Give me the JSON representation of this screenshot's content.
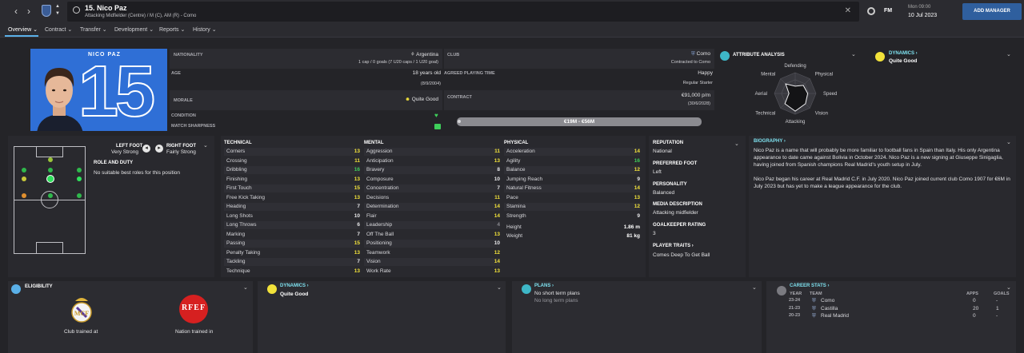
{
  "topbar": {
    "title": "15. Nico Paz",
    "subtitle": "Attacking Midfielder (Centre) / M (C), AM (R) - Como",
    "fm_label": "FM",
    "time": "Mon 09:00",
    "date": "10 Jul 2023",
    "add_manager": "ADD MANAGER"
  },
  "tabs": [
    "Overview",
    "Contract",
    "Transfer",
    "Development",
    "Reports",
    "History"
  ],
  "card": {
    "name": "NICO PAZ",
    "number": "15"
  },
  "info": {
    "nationality_label": "NATIONALITY",
    "nationality": "Argentina",
    "caps": "1 cap / 0 goals (7 U20 caps / 1 U20 goal)",
    "club_label": "CLUB",
    "club": "Como",
    "club_status": "Contracted to Como",
    "age_label": "AGE",
    "age": "18 years old",
    "dob": "(8/9/2004)",
    "playing_time_label": "AGREED PLAYING TIME",
    "happiness": "Happy",
    "playing_time": "Regular Starter",
    "morale_label": "MORALE",
    "morale": "Quite Good",
    "contract_label": "CONTRACT",
    "wage": "€91,000 p/m",
    "contract_end": "(30/6/2028)",
    "condition_label": "CONDITION",
    "sharpness_label": "MATCH SHARPNESS",
    "value_range": "€19M - €56M"
  },
  "attribute_analysis": {
    "title": "ATTRIBUTE ANALYSIS",
    "labels": [
      "Defending",
      "Physical",
      "Speed",
      "Vision",
      "Attacking",
      "Technical",
      "Aerial",
      "Mental"
    ],
    "values": [
      0.35,
      0.55,
      0.6,
      0.7,
      0.85,
      0.7,
      0.3,
      0.65
    ]
  },
  "dynamics_top": {
    "title": "DYNAMICS",
    "value": "Quite Good"
  },
  "feet": {
    "left_label": "LEFT FOOT",
    "left": "Very Strong",
    "right_label": "RIGHT FOOT",
    "right": "Fairly Strong"
  },
  "role": {
    "title": "ROLE AND DUTY",
    "text": "No suitable best roles for this position"
  },
  "technical": {
    "title": "TECHNICAL",
    "items": [
      {
        "name": "Corners",
        "value": "13"
      },
      {
        "name": "Crossing",
        "value": "11"
      },
      {
        "name": "Dribbling",
        "value": "16"
      },
      {
        "name": "Finishing",
        "value": "13"
      },
      {
        "name": "First Touch",
        "value": "15"
      },
      {
        "name": "Free Kick Taking",
        "value": "13"
      },
      {
        "name": "Heading",
        "value": "7"
      },
      {
        "name": "Long Shots",
        "value": "10"
      },
      {
        "name": "Long Throws",
        "value": "6"
      },
      {
        "name": "Marking",
        "value": "7"
      },
      {
        "name": "Passing",
        "value": "15"
      },
      {
        "name": "Penalty Taking",
        "value": "13"
      },
      {
        "name": "Tackling",
        "value": "7"
      },
      {
        "name": "Technique",
        "value": "13"
      }
    ]
  },
  "mental": {
    "title": "MENTAL",
    "items": [
      {
        "name": "Aggression",
        "value": "11"
      },
      {
        "name": "Anticipation",
        "value": "13"
      },
      {
        "name": "Bravery",
        "value": "8"
      },
      {
        "name": "Composure",
        "value": "10"
      },
      {
        "name": "Concentration",
        "value": "7"
      },
      {
        "name": "Decisions",
        "value": "11"
      },
      {
        "name": "Determination",
        "value": "14"
      },
      {
        "name": "Flair",
        "value": "14"
      },
      {
        "name": "Leadership",
        "value": "4"
      },
      {
        "name": "Off The Ball",
        "value": "13"
      },
      {
        "name": "Positioning",
        "value": "10"
      },
      {
        "name": "Teamwork",
        "value": "12"
      },
      {
        "name": "Vision",
        "value": "14"
      },
      {
        "name": "Work Rate",
        "value": "13"
      }
    ]
  },
  "physical": {
    "title": "PHYSICAL",
    "items": [
      {
        "name": "Acceleration",
        "value": "14"
      },
      {
        "name": "Agility",
        "value": "16"
      },
      {
        "name": "Balance",
        "value": "12"
      },
      {
        "name": "Jumping Reach",
        "value": "9"
      },
      {
        "name": "Natural Fitness",
        "value": "14"
      },
      {
        "name": "Pace",
        "value": "13"
      },
      {
        "name": "Stamina",
        "value": "12"
      },
      {
        "name": "Strength",
        "value": "9"
      }
    ],
    "height_label": "Height",
    "height": "1.86 m",
    "weight_label": "Weight",
    "weight": "81 kg"
  },
  "side": {
    "reputation_label": "REPUTATION",
    "reputation": "National",
    "foot_label": "PREFERRED FOOT",
    "foot": "Left",
    "personality_label": "PERSONALITY",
    "personality": "Balanced",
    "media_label": "MEDIA DESCRIPTION",
    "media": "Attacking midfielder",
    "gk_label": "GOALKEEPER RATING",
    "gk": "3",
    "traits_label": "PLAYER TRAITS",
    "traits": "Comes Deep To Get Ball"
  },
  "biography": {
    "title": "BIOGRAPHY",
    "p1": "Nico Paz is a name that will probably be more familiar to football fans in Spain than Italy. His only Argentina appearance to date came against Bolivia in October 2024. Nico Paz is a new signing at Giuseppe Sinigaglia, having joined from Spanish champions Real Madrid's youth setup in July.",
    "p2": "Nico Paz began his career at Real Madrid C.F. in July 2020. Nico Paz joined current club Como 1907 for €6M in July 2023 but has yet to make a league appearance for the club."
  },
  "eligibility": {
    "title": "ELIGIBILITY",
    "club_trained": "Club trained at",
    "nation_trained": "Nation trained in",
    "crest2_text": "RFEF"
  },
  "dynamics_bottom": {
    "title": "DYNAMICS",
    "value": "Quite Good"
  },
  "plans": {
    "title": "PLANS",
    "short": "No short term plans",
    "long": "No long term plans"
  },
  "career": {
    "title": "CAREER STATS",
    "col_year": "YEAR",
    "col_team": "TEAM",
    "col_apps": "APPS",
    "col_goals": "GOALS",
    "rows": [
      {
        "year": "23-24",
        "team": "Como",
        "apps": "0",
        "goals": "-"
      },
      {
        "year": "21-23",
        "team": "Castilla",
        "apps": "20",
        "goals": "1"
      },
      {
        "year": "20-23",
        "team": "Real Madrid",
        "apps": "0",
        "goals": "-"
      }
    ]
  },
  "colors": {
    "accent": "#5ab0e8",
    "card_blue": "#2f6fd6",
    "green": "#3ecf5a",
    "yellow": "#f2e23a",
    "cyan": "#7ee0ee"
  }
}
